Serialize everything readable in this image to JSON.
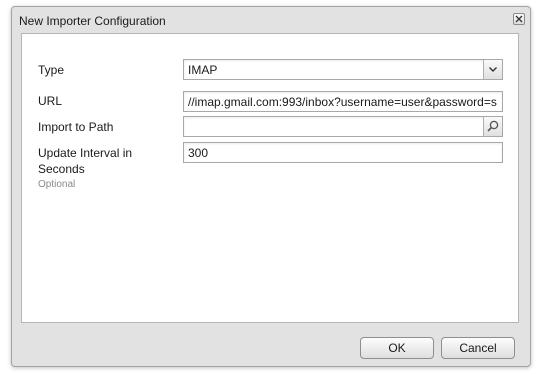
{
  "dialog": {
    "title": "New Importer Configuration",
    "close_icon": "close-icon"
  },
  "form": {
    "type": {
      "label": "Type",
      "value": "IMAP",
      "icon": "chevron-down-icon"
    },
    "url": {
      "label": "URL",
      "value": "//imap.gmail.com:993/inbox?username=user&password=s"
    },
    "import_path": {
      "label": "Import to Path",
      "value": "",
      "icon": "search-icon"
    },
    "interval": {
      "label_line1": "Update Interval in",
      "label_line2": "Seconds",
      "optional": "Optional",
      "value": "300"
    }
  },
  "buttons": {
    "ok": "OK",
    "cancel": "Cancel"
  }
}
